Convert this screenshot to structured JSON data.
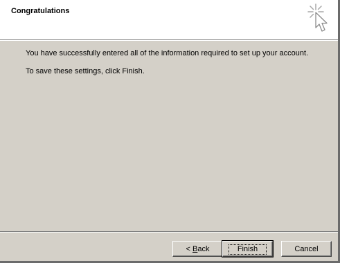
{
  "header": {
    "title": "Congratulations",
    "icon": "wizard-cursor-icon"
  },
  "content": {
    "line1": "You have successfully entered all of the information required to set up your account.",
    "line2": "To save these settings, click Finish."
  },
  "buttons": {
    "back_prefix": "< ",
    "back_accel": "B",
    "back_rest": "ack",
    "finish": "Finish",
    "cancel": "Cancel"
  },
  "colors": {
    "dialog_face": "#d4d0c8",
    "header_bg": "#ffffff"
  }
}
